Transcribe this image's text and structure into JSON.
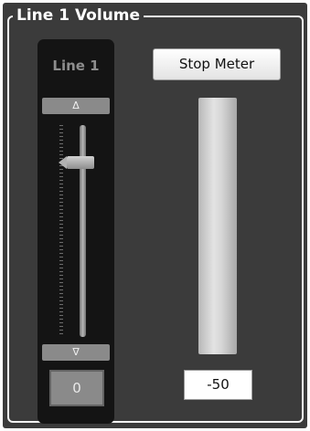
{
  "group": {
    "title": "Line 1 Volume"
  },
  "fader": {
    "channel_label": "Line 1",
    "step_up_glyph": "Δ",
    "step_down_glyph": "∇",
    "value": "0"
  },
  "meter": {
    "stop_button_label": "Stop Meter",
    "readout": "-50"
  },
  "colors": {
    "panel_background": "#3b3b3b",
    "strip_background": "#141414",
    "group_border": "#f4f4f4"
  }
}
